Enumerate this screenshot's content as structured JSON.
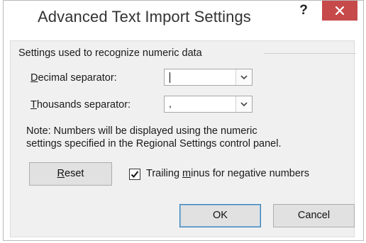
{
  "window": {
    "title": "Advanced Text Import Settings",
    "help_label": "?",
    "close_icon": "close-icon"
  },
  "group": {
    "label": "Settings used to recognize numeric data"
  },
  "decimal": {
    "label_accel": "D",
    "label_rest": "ecimal separator:",
    "value": ""
  },
  "thousands": {
    "label_accel": "T",
    "label_rest": "housands separator:",
    "value": ","
  },
  "note": {
    "line1": "Note: Numbers will be displayed using the numeric",
    "line2": "settings specified in the Regional Settings control panel."
  },
  "reset_button": {
    "label_accel": "R",
    "label_rest": "eset"
  },
  "trailing_minus": {
    "checked": true,
    "label_pre": "Trailing ",
    "label_accel": "m",
    "label_post": "inus for negative numbers"
  },
  "ok_button": {
    "label": "OK"
  },
  "cancel_button": {
    "label": "Cancel"
  },
  "colors": {
    "close_bg": "#c74a4a",
    "default_button_border": "#3c7fb1",
    "dialog_bg": "#f0f0f0"
  }
}
